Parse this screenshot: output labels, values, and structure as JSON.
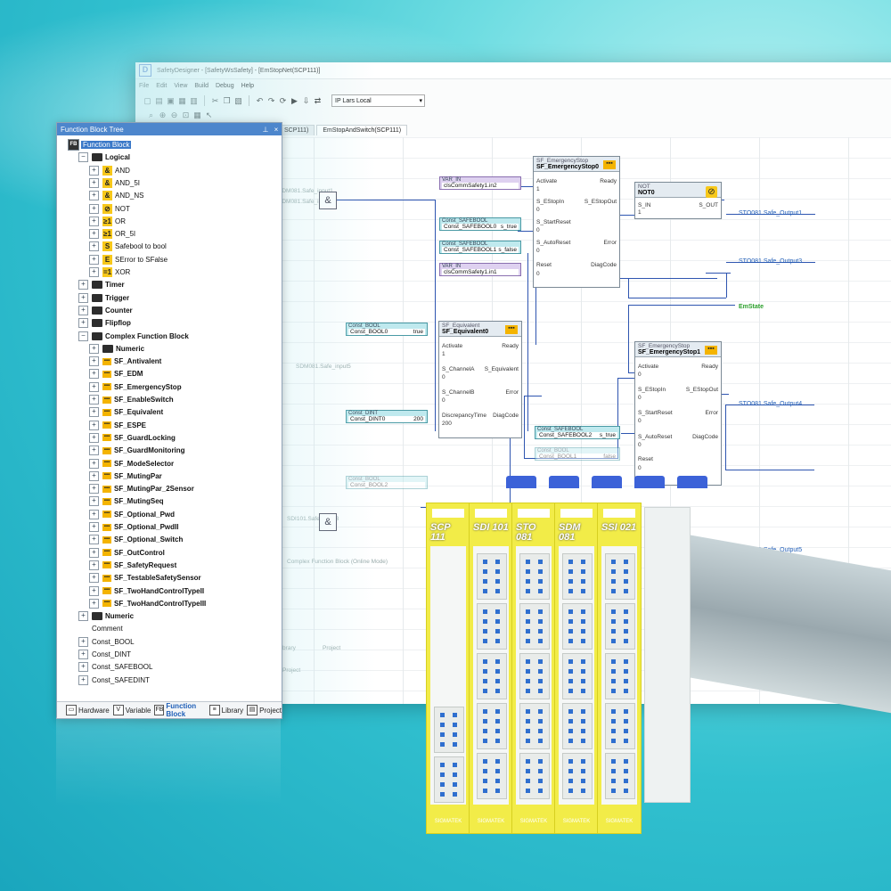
{
  "app": {
    "title": "SafetyDesigner - [SafetyWsSafety] - [EmStopNet(SCP111)]",
    "icon": "app-logo-icon",
    "menu": [
      "File",
      "Edit",
      "View",
      "Build",
      "Debug",
      "Help"
    ],
    "target_select": "IP Lars Local",
    "tabs": [
      "SCP111)",
      "EmStopAndSwitch(SCP111)"
    ],
    "ghost_labels": [
      "Function",
      "Function",
      "Safety",
      "Safety"
    ],
    "faint_comment": "Complex Function Block (Online Mode)",
    "faint_tabs": [
      "Library",
      "Project"
    ]
  },
  "diagram": {
    "left_inputs": [
      "SDM081.Safe_input1",
      "SDM081.Safe_input2",
      "SDM081.Safe_input5",
      "SDI101.Safe_input3"
    ],
    "blocks": {
      "emstop0": {
        "type": "SF_EmergencyStop",
        "name": "SF_EmergencyStop0",
        "in": [
          "Activate",
          "S_EStopIn",
          "S_StartReset",
          "S_AutoReset",
          "Reset"
        ],
        "in_vals": [
          "1",
          "0",
          "0",
          "0",
          "0"
        ],
        "out": [
          "Ready",
          "S_EStopOut",
          "Error",
          "DiagCode"
        ]
      },
      "not0": {
        "type": "NOT",
        "name": "NOT0",
        "in": [
          "S_IN"
        ],
        "in_vals": [
          "1"
        ],
        "out": [
          "S_OUT"
        ]
      },
      "equiv0": {
        "type": "SF_Equivalent",
        "name": "SF_Equivalent0",
        "in": [
          "Activate",
          "S_ChannelA",
          "S_ChannelB",
          "DiscrepancyTime"
        ],
        "in_vals": [
          "1",
          "0",
          "0",
          "200"
        ],
        "out": [
          "Ready",
          "S_Equivalent",
          "Error",
          "DiagCode"
        ]
      },
      "emstop1": {
        "type": "SF_EmergencyStop",
        "name": "SF_EmergencyStop1",
        "in": [
          "Activate",
          "S_EStopIn",
          "S_StartReset",
          "S_AutoReset",
          "Reset"
        ],
        "in_vals": [
          "0",
          "0",
          "0",
          "0",
          "0"
        ],
        "out": [
          "Ready",
          "S_EStopOut",
          "Error",
          "DiagCode"
        ]
      }
    },
    "vars": [
      {
        "type": "VAR_IN",
        "name": "clsCommSafety1.in2",
        "val": ""
      },
      {
        "type": "VAR_IN",
        "name": "clsCommSafety1.in1",
        "val": ""
      }
    ],
    "consts": [
      {
        "type": "Const_SAFEBOOL",
        "name": "Const_SAFEBOOL0",
        "val": "s_true"
      },
      {
        "type": "Const_SAFEBOOL",
        "name": "Const_SAFEBOOL1",
        "val": "s_false"
      },
      {
        "type": "Const_BOOL",
        "name": "Const_BOOL0",
        "val": "true"
      },
      {
        "type": "Const_DINT",
        "name": "Const_DINT0",
        "val": "200"
      },
      {
        "type": "Const_SAFEBOOL",
        "name": "Const_SAFEBOOL2",
        "val": "s_true"
      },
      {
        "type": "Const_BOOL",
        "name": "Const_BOOL1",
        "val": "false"
      },
      {
        "type": "Const_BOOL",
        "name": "Const_BOOL2",
        "val": ""
      }
    ],
    "outputs": [
      "STO081.Safe_Output1",
      "STO081.Safe_Output3",
      "EmState",
      "STO081.Safe_Output4",
      "STO081.Safe_Output5"
    ],
    "and_symbol": "&"
  },
  "tree_window": {
    "title": "Function Block Tree",
    "pin_icon": "pin-icon",
    "close_icon": "close-icon",
    "items": [
      {
        "label": "Function Block",
        "level": 0,
        "exp": "−",
        "icon": "fb",
        "selected": true
      },
      {
        "label": "Logical",
        "level": 1,
        "exp": "−",
        "icon": "folder",
        "bold": true
      },
      {
        "label": "AND",
        "level": 2,
        "exp": "+",
        "icon": "and",
        "glyph": "&"
      },
      {
        "label": "AND_5I",
        "level": 2,
        "exp": "+",
        "icon": "and",
        "glyph": "&"
      },
      {
        "label": "AND_NS",
        "level": 2,
        "exp": "+",
        "icon": "and",
        "glyph": "&"
      },
      {
        "label": "NOT",
        "level": 2,
        "exp": "+",
        "icon": "and",
        "glyph": "⊘"
      },
      {
        "label": "OR",
        "level": 2,
        "exp": "+",
        "icon": "and",
        "glyph": "≥1"
      },
      {
        "label": "OR_5I",
        "level": 2,
        "exp": "+",
        "icon": "and",
        "glyph": "≥1"
      },
      {
        "label": "Safebool to bool",
        "level": 2,
        "exp": "+",
        "icon": "and",
        "glyph": "S"
      },
      {
        "label": "SError to SFalse",
        "level": 2,
        "exp": "+",
        "icon": "and",
        "glyph": "E"
      },
      {
        "label": "XOR",
        "level": 2,
        "exp": "+",
        "icon": "and",
        "glyph": "=1"
      },
      {
        "label": "Timer",
        "level": 1,
        "exp": "+",
        "icon": "folder",
        "bold": true
      },
      {
        "label": "Trigger",
        "level": 1,
        "exp": "+",
        "icon": "folder",
        "bold": true
      },
      {
        "label": "Counter",
        "level": 1,
        "exp": "+",
        "icon": "folder",
        "bold": true
      },
      {
        "label": "Flipflop",
        "level": 1,
        "exp": "+",
        "icon": "folder",
        "bold": true
      },
      {
        "label": "Complex Function Block",
        "level": 1,
        "exp": "−",
        "icon": "folder",
        "bold": true
      },
      {
        "label": "Numeric",
        "level": 2,
        "exp": "+",
        "icon": "folder",
        "bold": true
      },
      {
        "label": "SF_Antivalent",
        "level": 2,
        "exp": "+",
        "icon": "sf",
        "bold": true
      },
      {
        "label": "SF_EDM",
        "level": 2,
        "exp": "+",
        "icon": "sf",
        "bold": true
      },
      {
        "label": "SF_EmergencyStop",
        "level": 2,
        "exp": "+",
        "icon": "sf",
        "bold": true
      },
      {
        "label": "SF_EnableSwitch",
        "level": 2,
        "exp": "+",
        "icon": "sf",
        "bold": true
      },
      {
        "label": "SF_Equivalent",
        "level": 2,
        "exp": "+",
        "icon": "sf",
        "bold": true
      },
      {
        "label": "SF_ESPE",
        "level": 2,
        "exp": "+",
        "icon": "sf",
        "bold": true
      },
      {
        "label": "SF_GuardLocking",
        "level": 2,
        "exp": "+",
        "icon": "sf",
        "bold": true
      },
      {
        "label": "SF_GuardMonitoring",
        "level": 2,
        "exp": "+",
        "icon": "sf",
        "bold": true
      },
      {
        "label": "SF_ModeSelector",
        "level": 2,
        "exp": "+",
        "icon": "sf",
        "bold": true
      },
      {
        "label": "SF_MutingPar",
        "level": 2,
        "exp": "+",
        "icon": "sf",
        "bold": true
      },
      {
        "label": "SF_MutingPar_2Sensor",
        "level": 2,
        "exp": "+",
        "icon": "sf",
        "bold": true
      },
      {
        "label": "SF_MutingSeq",
        "level": 2,
        "exp": "+",
        "icon": "sf",
        "bold": true
      },
      {
        "label": "SF_Optional_Pwd",
        "level": 2,
        "exp": "+",
        "icon": "sf",
        "bold": true
      },
      {
        "label": "SF_Optional_PwdII",
        "level": 2,
        "exp": "+",
        "icon": "sf",
        "bold": true
      },
      {
        "label": "SF_Optional_Switch",
        "level": 2,
        "exp": "+",
        "icon": "sf",
        "bold": true
      },
      {
        "label": "SF_OutControl",
        "level": 2,
        "exp": "+",
        "icon": "sf",
        "bold": true
      },
      {
        "label": "SF_SafetyRequest",
        "level": 2,
        "exp": "+",
        "icon": "sf",
        "bold": true
      },
      {
        "label": "SF_TestableSafetySensor",
        "level": 2,
        "exp": "+",
        "icon": "sf",
        "bold": true
      },
      {
        "label": "SF_TwoHandControlTypeII",
        "level": 2,
        "exp": "+",
        "icon": "sf",
        "bold": true
      },
      {
        "label": "SF_TwoHandControlTypeIII",
        "level": 2,
        "exp": "+",
        "icon": "sf",
        "bold": true
      },
      {
        "label": "Numeric",
        "level": 1,
        "exp": "+",
        "icon": "folder",
        "bold": true
      },
      {
        "label": "Comment",
        "level": 1,
        "exp": "",
        "icon": "none"
      },
      {
        "label": "Const_BOOL",
        "level": 1,
        "exp": "+",
        "icon": "none"
      },
      {
        "label": "Const_DINT",
        "level": 1,
        "exp": "+",
        "icon": "none"
      },
      {
        "label": "Const_SAFEBOOL",
        "level": 1,
        "exp": "+",
        "icon": "none"
      },
      {
        "label": "Const_SAFEDINT",
        "level": 1,
        "exp": "+",
        "icon": "none"
      }
    ],
    "bottom_tabs": [
      {
        "label": "Hardware",
        "icon": "hardware-icon",
        "glyph": "▭"
      },
      {
        "label": "Variable",
        "icon": "variable-icon",
        "glyph": "V"
      },
      {
        "label": "Function Block",
        "icon": "function-block-icon",
        "glyph": "FB",
        "active": true
      },
      {
        "label": "Library",
        "icon": "library-icon",
        "glyph": "≡"
      },
      {
        "label": "Project",
        "icon": "project-icon",
        "glyph": "▤"
      }
    ]
  },
  "device": {
    "modules": [
      {
        "code": "SCP 111"
      },
      {
        "code": "SDI 101"
      },
      {
        "code": "STO 081"
      },
      {
        "code": "SDM 081"
      },
      {
        "code": "SSI 021"
      }
    ],
    "brand": "SIGMATEK"
  },
  "colors": {
    "module_yellow": "#f2ec48",
    "terminal_blue": "#2f6fcf",
    "selection_blue": "#3a78c8",
    "wire_blue": "#2e55b0"
  }
}
